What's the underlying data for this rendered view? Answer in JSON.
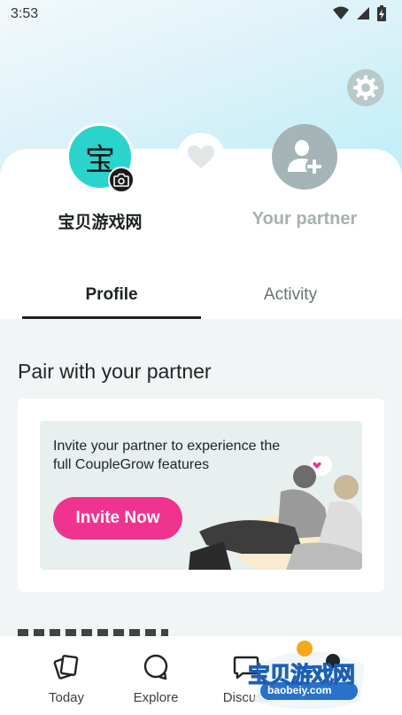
{
  "status_bar": {
    "time": "3:53"
  },
  "profile": {
    "user_avatar_char": "宝",
    "user_name": "宝贝游戏网",
    "partner_label": "Your partner"
  },
  "tabs": [
    {
      "label": "Profile",
      "active": true
    },
    {
      "label": "Activity",
      "active": false
    }
  ],
  "pair_section": {
    "title": "Pair with your partner",
    "invite_text": "Invite your partner to experience the full CoupleGrow features",
    "invite_button": "Invite Now"
  },
  "bottom_nav": [
    {
      "label": "Today",
      "icon": "cards-icon"
    },
    {
      "label": "Explore",
      "icon": "explore-icon"
    },
    {
      "label": "Discuss",
      "icon": "chat-bubble-icon"
    }
  ],
  "watermark": {
    "text": "宝贝游戏网",
    "url": "baobeiy.com"
  },
  "colors": {
    "accent_pink": "#f0338f",
    "avatar_teal": "#2ad4cc",
    "partner_gray": "#a5b4b6",
    "header_gradient_end": "#b8eef8"
  }
}
